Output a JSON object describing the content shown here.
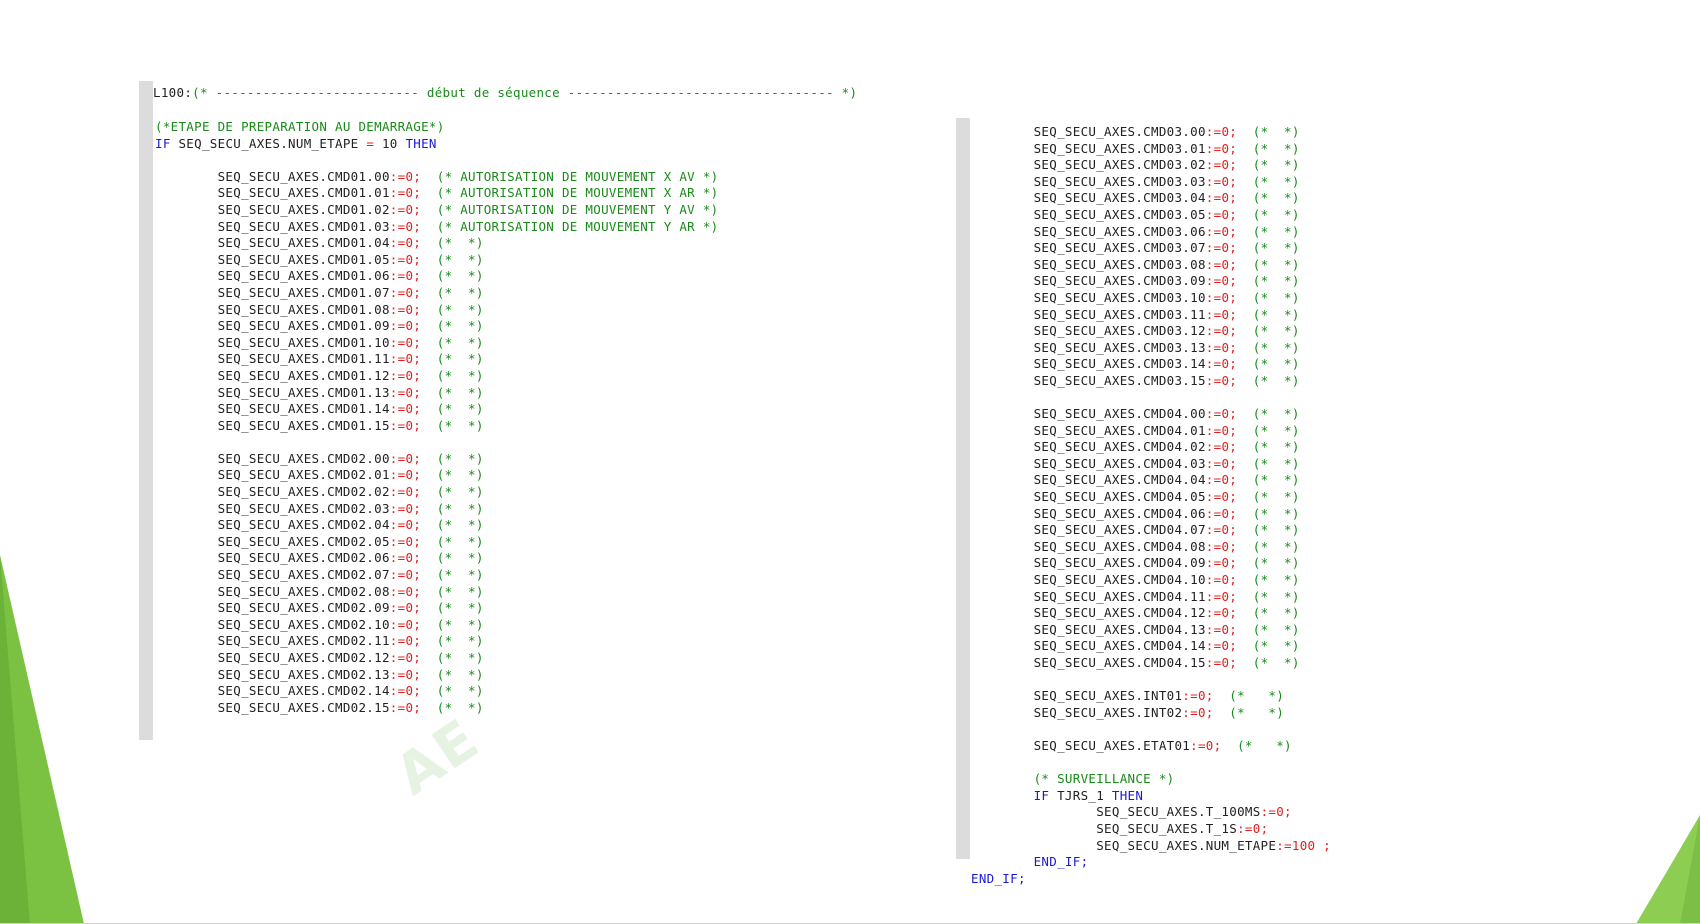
{
  "header": {
    "label": "L100",
    "colon": ":",
    "comment": "(* -------------------------- début de séquence ---------------------------------- *)"
  },
  "left_block": {
    "step_comment": "(*ETAPE DE PREPARATION AU DEMARRAGE*)",
    "if_keyword": "IF",
    "condition_var": "SEQ_SECU_AXES.NUM_ETAPE",
    "condition_op": "=",
    "condition_value": "10",
    "then_keyword": "THEN",
    "group1": [
      {
        "var": "SEQ_SECU_AXES.CMD01.00",
        "op": ":=",
        "val": "0;",
        "comment": "(* AUTORISATION DE MOUVEMENT X AV *)"
      },
      {
        "var": "SEQ_SECU_AXES.CMD01.01",
        "op": ":=",
        "val": "0;",
        "comment": "(* AUTORISATION DE MOUVEMENT X AR *)"
      },
      {
        "var": "SEQ_SECU_AXES.CMD01.02",
        "op": ":=",
        "val": "0;",
        "comment": "(* AUTORISATION DE MOUVEMENT Y AV *)"
      },
      {
        "var": "SEQ_SECU_AXES.CMD01.03",
        "op": ":=",
        "val": "0;",
        "comment": "(* AUTORISATION DE MOUVEMENT Y AR *)"
      },
      {
        "var": "SEQ_SECU_AXES.CMD01.04",
        "op": ":=",
        "val": "0;",
        "comment": "(*  *)"
      },
      {
        "var": "SEQ_SECU_AXES.CMD01.05",
        "op": ":=",
        "val": "0;",
        "comment": "(*  *)"
      },
      {
        "var": "SEQ_SECU_AXES.CMD01.06",
        "op": ":=",
        "val": "0;",
        "comment": "(*  *)"
      },
      {
        "var": "SEQ_SECU_AXES.CMD01.07",
        "op": ":=",
        "val": "0;",
        "comment": "(*  *)"
      },
      {
        "var": "SEQ_SECU_AXES.CMD01.08",
        "op": ":=",
        "val": "0;",
        "comment": "(*  *)"
      },
      {
        "var": "SEQ_SECU_AXES.CMD01.09",
        "op": ":=",
        "val": "0;",
        "comment": "(*  *)"
      },
      {
        "var": "SEQ_SECU_AXES.CMD01.10",
        "op": ":=",
        "val": "0;",
        "comment": "(*  *)"
      },
      {
        "var": "SEQ_SECU_AXES.CMD01.11",
        "op": ":=",
        "val": "0;",
        "comment": "(*  *)"
      },
      {
        "var": "SEQ_SECU_AXES.CMD01.12",
        "op": ":=",
        "val": "0;",
        "comment": "(*  *)"
      },
      {
        "var": "SEQ_SECU_AXES.CMD01.13",
        "op": ":=",
        "val": "0;",
        "comment": "(*  *)"
      },
      {
        "var": "SEQ_SECU_AXES.CMD01.14",
        "op": ":=",
        "val": "0;",
        "comment": "(*  *)"
      },
      {
        "var": "SEQ_SECU_AXES.CMD01.15",
        "op": ":=",
        "val": "0;",
        "comment": "(*  *)"
      }
    ],
    "group2": [
      {
        "var": "SEQ_SECU_AXES.CMD02.00",
        "op": ":=",
        "val": "0;",
        "comment": "(*  *)"
      },
      {
        "var": "SEQ_SECU_AXES.CMD02.01",
        "op": ":=",
        "val": "0;",
        "comment": "(*  *)"
      },
      {
        "var": "SEQ_SECU_AXES.CMD02.02",
        "op": ":=",
        "val": "0;",
        "comment": "(*  *)"
      },
      {
        "var": "SEQ_SECU_AXES.CMD02.03",
        "op": ":=",
        "val": "0;",
        "comment": "(*  *)"
      },
      {
        "var": "SEQ_SECU_AXES.CMD02.04",
        "op": ":=",
        "val": "0;",
        "comment": "(*  *)"
      },
      {
        "var": "SEQ_SECU_AXES.CMD02.05",
        "op": ":=",
        "val": "0;",
        "comment": "(*  *)"
      },
      {
        "var": "SEQ_SECU_AXES.CMD02.06",
        "op": ":=",
        "val": "0;",
        "comment": "(*  *)"
      },
      {
        "var": "SEQ_SECU_AXES.CMD02.07",
        "op": ":=",
        "val": "0;",
        "comment": "(*  *)"
      },
      {
        "var": "SEQ_SECU_AXES.CMD02.08",
        "op": ":=",
        "val": "0;",
        "comment": "(*  *)"
      },
      {
        "var": "SEQ_SECU_AXES.CMD02.09",
        "op": ":=",
        "val": "0;",
        "comment": "(*  *)"
      },
      {
        "var": "SEQ_SECU_AXES.CMD02.10",
        "op": ":=",
        "val": "0;",
        "comment": "(*  *)"
      },
      {
        "var": "SEQ_SECU_AXES.CMD02.11",
        "op": ":=",
        "val": "0;",
        "comment": "(*  *)"
      },
      {
        "var": "SEQ_SECU_AXES.CMD02.12",
        "op": ":=",
        "val": "0;",
        "comment": "(*  *)"
      },
      {
        "var": "SEQ_SECU_AXES.CMD02.13",
        "op": ":=",
        "val": "0;",
        "comment": "(*  *)"
      },
      {
        "var": "SEQ_SECU_AXES.CMD02.14",
        "op": ":=",
        "val": "0;",
        "comment": "(*  *)"
      },
      {
        "var": "SEQ_SECU_AXES.CMD02.15",
        "op": ":=",
        "val": "0;",
        "comment": "(*  *)"
      }
    ]
  },
  "right_block": {
    "group3": [
      {
        "var": "SEQ_SECU_AXES.CMD03.00",
        "op": ":=",
        "val": "0;",
        "comment": "(*  *)"
      },
      {
        "var": "SEQ_SECU_AXES.CMD03.01",
        "op": ":=",
        "val": "0;",
        "comment": "(*  *)"
      },
      {
        "var": "SEQ_SECU_AXES.CMD03.02",
        "op": ":=",
        "val": "0;",
        "comment": "(*  *)"
      },
      {
        "var": "SEQ_SECU_AXES.CMD03.03",
        "op": ":=",
        "val": "0;",
        "comment": "(*  *)"
      },
      {
        "var": "SEQ_SECU_AXES.CMD03.04",
        "op": ":=",
        "val": "0;",
        "comment": "(*  *)"
      },
      {
        "var": "SEQ_SECU_AXES.CMD03.05",
        "op": ":=",
        "val": "0;",
        "comment": "(*  *)"
      },
      {
        "var": "SEQ_SECU_AXES.CMD03.06",
        "op": ":=",
        "val": "0;",
        "comment": "(*  *)"
      },
      {
        "var": "SEQ_SECU_AXES.CMD03.07",
        "op": ":=",
        "val": "0;",
        "comment": "(*  *)"
      },
      {
        "var": "SEQ_SECU_AXES.CMD03.08",
        "op": ":=",
        "val": "0;",
        "comment": "(*  *)"
      },
      {
        "var": "SEQ_SECU_AXES.CMD03.09",
        "op": ":=",
        "val": "0;",
        "comment": "(*  *)"
      },
      {
        "var": "SEQ_SECU_AXES.CMD03.10",
        "op": ":=",
        "val": "0;",
        "comment": "(*  *)"
      },
      {
        "var": "SEQ_SECU_AXES.CMD03.11",
        "op": ":=",
        "val": "0;",
        "comment": "(*  *)"
      },
      {
        "var": "SEQ_SECU_AXES.CMD03.12",
        "op": ":=",
        "val": "0;",
        "comment": "(*  *)"
      },
      {
        "var": "SEQ_SECU_AXES.CMD03.13",
        "op": ":=",
        "val": "0;",
        "comment": "(*  *)"
      },
      {
        "var": "SEQ_SECU_AXES.CMD03.14",
        "op": ":=",
        "val": "0;",
        "comment": "(*  *)"
      },
      {
        "var": "SEQ_SECU_AXES.CMD03.15",
        "op": ":=",
        "val": "0;",
        "comment": "(*  *)"
      }
    ],
    "group4": [
      {
        "var": "SEQ_SECU_AXES.CMD04.00",
        "op": ":=",
        "val": "0;",
        "comment": "(*  *)"
      },
      {
        "var": "SEQ_SECU_AXES.CMD04.01",
        "op": ":=",
        "val": "0;",
        "comment": "(*  *)"
      },
      {
        "var": "SEQ_SECU_AXES.CMD04.02",
        "op": ":=",
        "val": "0;",
        "comment": "(*  *)"
      },
      {
        "var": "SEQ_SECU_AXES.CMD04.03",
        "op": ":=",
        "val": "0;",
        "comment": "(*  *)"
      },
      {
        "var": "SEQ_SECU_AXES.CMD04.04",
        "op": ":=",
        "val": "0;",
        "comment": "(*  *)"
      },
      {
        "var": "SEQ_SECU_AXES.CMD04.05",
        "op": ":=",
        "val": "0;",
        "comment": "(*  *)"
      },
      {
        "var": "SEQ_SECU_AXES.CMD04.06",
        "op": ":=",
        "val": "0;",
        "comment": "(*  *)"
      },
      {
        "var": "SEQ_SECU_AXES.CMD04.07",
        "op": ":=",
        "val": "0;",
        "comment": "(*  *)"
      },
      {
        "var": "SEQ_SECU_AXES.CMD04.08",
        "op": ":=",
        "val": "0;",
        "comment": "(*  *)"
      },
      {
        "var": "SEQ_SECU_AXES.CMD04.09",
        "op": ":=",
        "val": "0;",
        "comment": "(*  *)"
      },
      {
        "var": "SEQ_SECU_AXES.CMD04.10",
        "op": ":=",
        "val": "0;",
        "comment": "(*  *)"
      },
      {
        "var": "SEQ_SECU_AXES.CMD04.11",
        "op": ":=",
        "val": "0;",
        "comment": "(*  *)"
      },
      {
        "var": "SEQ_SECU_AXES.CMD04.12",
        "op": ":=",
        "val": "0;",
        "comment": "(*  *)"
      },
      {
        "var": "SEQ_SECU_AXES.CMD04.13",
        "op": ":=",
        "val": "0;",
        "comment": "(*  *)"
      },
      {
        "var": "SEQ_SECU_AXES.CMD04.14",
        "op": ":=",
        "val": "0;",
        "comment": "(*  *)"
      },
      {
        "var": "SEQ_SECU_AXES.CMD04.15",
        "op": ":=",
        "val": "0;",
        "comment": "(*  *)"
      }
    ],
    "group5": [
      {
        "var": "SEQ_SECU_AXES.INT01",
        "op": ":=",
        "val": "0;",
        "comment": "(*   *)"
      },
      {
        "var": "SEQ_SECU_AXES.INT02",
        "op": ":=",
        "val": "0;",
        "comment": "(*   *)"
      }
    ],
    "group6": [
      {
        "var": "SEQ_SECU_AXES.ETAT01",
        "op": ":=",
        "val": "0;",
        "comment": "(*   *)"
      }
    ],
    "surveillance_comment": "(* SURVEILLANCE *)",
    "inner_if_keyword": "IF",
    "inner_condition": "TJRS_1",
    "inner_then_keyword": "THEN",
    "inner_assignments": [
      {
        "var": "SEQ_SECU_AXES.T_100MS",
        "op": ":=",
        "val": "0;"
      },
      {
        "var": "SEQ_SECU_AXES.T_1S",
        "op": ":=",
        "val": "0;"
      },
      {
        "var": "SEQ_SECU_AXES.NUM_ETAPE",
        "op": ":=",
        "val": "100 ;"
      }
    ],
    "inner_end_if": "END_IF;",
    "outer_end_if": "END_IF;"
  },
  "watermark_text": "AE",
  "colors": {
    "keyword": "#1a1ad6",
    "operator": "#e02020",
    "comment": "#1a8a1a",
    "accent_green": "#78c23c"
  }
}
